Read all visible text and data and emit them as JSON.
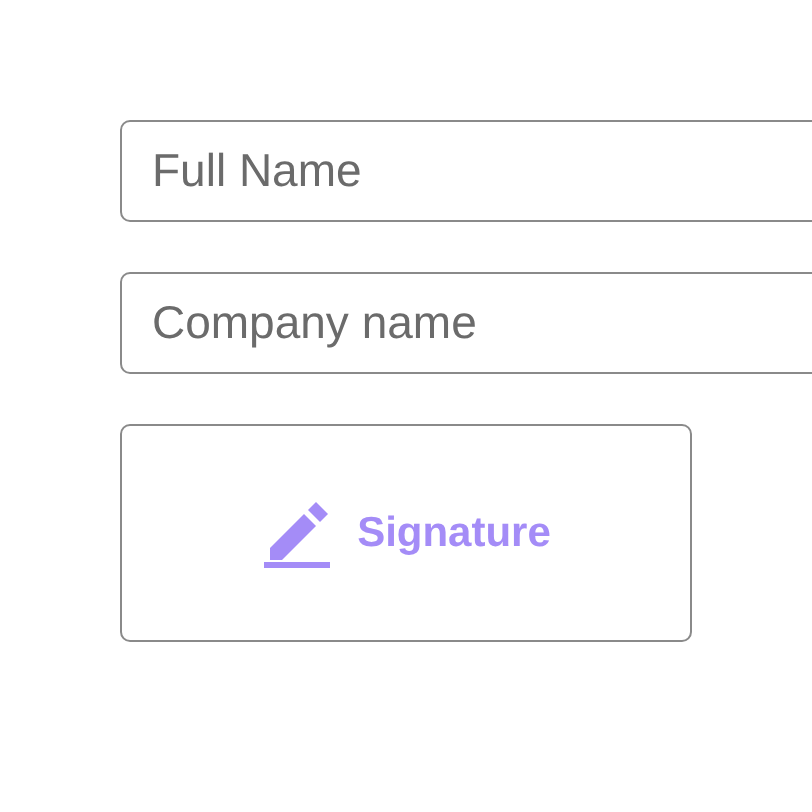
{
  "fields": [
    {
      "placeholder": "Full Name"
    },
    {
      "placeholder": "Company name"
    }
  ],
  "signature_button": {
    "label": "Signature"
  }
}
